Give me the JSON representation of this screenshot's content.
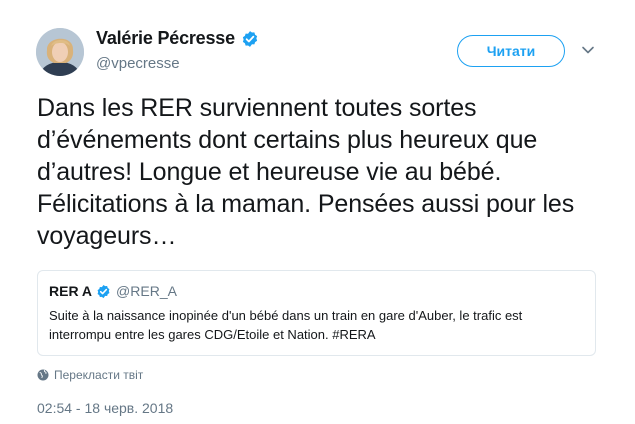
{
  "author": {
    "display_name": "Valérie Pécresse",
    "handle": "@vpecresse",
    "verified": true
  },
  "follow_button": {
    "label": "Читати"
  },
  "tweet": {
    "text": "Dans les RER surviennent toutes sortes d’événements dont certains plus heureux que d’autres! Longue et heureuse vie au bébé. Félicitations à la maman. Pensées aussi pour les voyageurs…"
  },
  "quoted_tweet": {
    "display_name": "RER A",
    "handle": "@RER_A",
    "verified": true,
    "text": "Suite à la naissance inopinée d'un bébé dans un train en gare d'Auber, le trafic est interrompu entre les gares CDG/Etoile et Nation. #RERA"
  },
  "translate": {
    "label": "Перекласти твіт",
    "icon": "globe-icon"
  },
  "timestamp": "02:54 - 18 черв. 2018",
  "colors": {
    "accent": "#1da1f2",
    "text": "#14171a",
    "secondary": "#657786",
    "border": "#e1e8ed"
  }
}
